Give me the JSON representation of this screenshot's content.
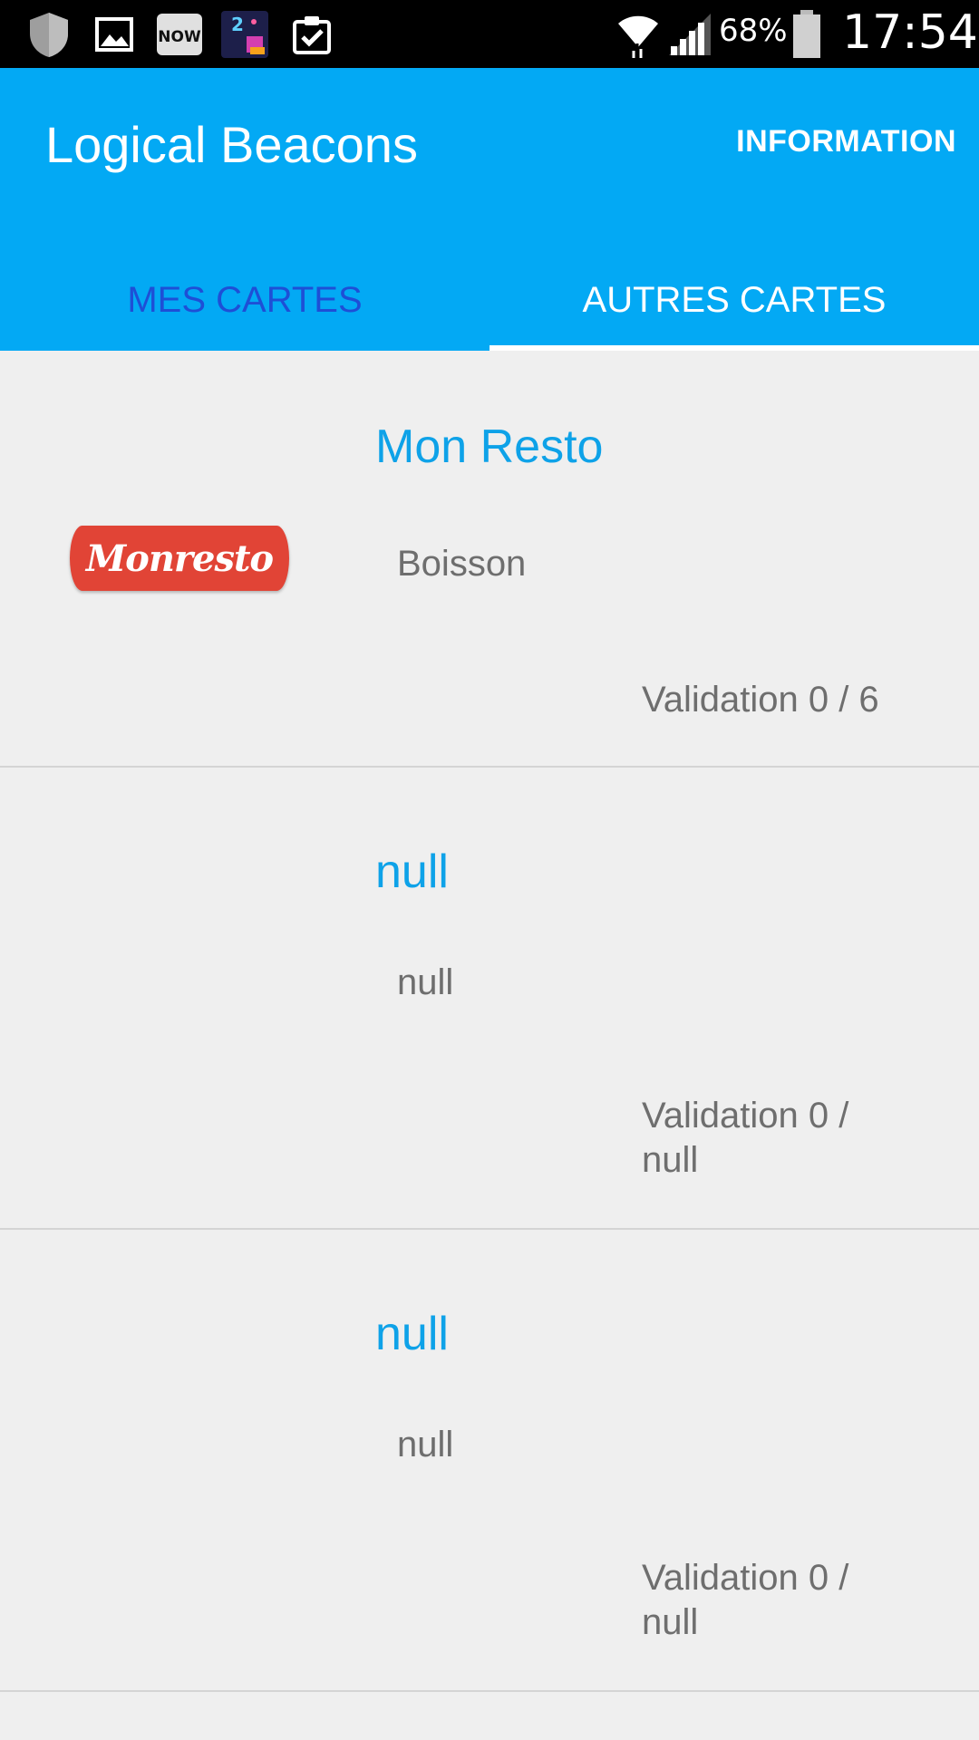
{
  "status_bar": {
    "battery_percent": "68%",
    "time": "17:54",
    "icons": [
      "shield-icon",
      "image-icon",
      "now-app-icon",
      "game-app-icon",
      "clipboard-check-icon",
      "wifi-icon",
      "signal-icon",
      "battery-icon"
    ]
  },
  "app_bar": {
    "title": "Logical Beacons",
    "action_label": "INFORMATION"
  },
  "tabs": [
    {
      "label": "MES CARTES",
      "selected": false
    },
    {
      "label": "AUTRES CARTES",
      "selected": true
    }
  ],
  "cards": [
    {
      "title": "Mon Resto",
      "subtitle": "Boisson",
      "validation": "Validation 0 / 6",
      "logo_text": "Monresto"
    },
    {
      "title": "null",
      "subtitle": "null",
      "validation": "Validation 0 / null"
    },
    {
      "title": "null",
      "subtitle": "null",
      "validation": "Validation 0 / null"
    }
  ],
  "colors": {
    "app_bar": "#03a9f4",
    "card_title": "#0ea2e8",
    "selected_tab_indicator": "#ffffff",
    "logo_background": "#e14436"
  }
}
